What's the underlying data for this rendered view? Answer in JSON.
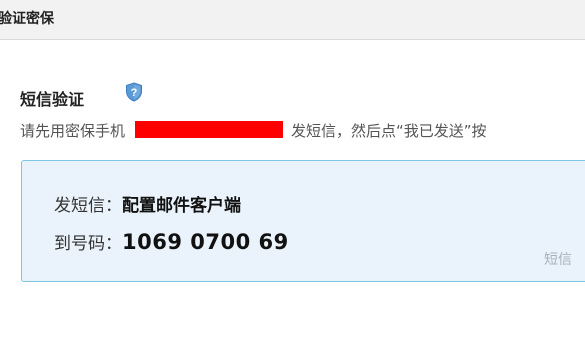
{
  "header": {
    "title": "验证密保"
  },
  "sms_section": {
    "title": "短信验证",
    "help_icon": "shield-question-icon",
    "instruction_prefix": "请先用密保手机",
    "instruction_suffix": "发短信，然后点“我已发送”按"
  },
  "sms_box": {
    "content_label": "发短信：",
    "content_value": "配置邮件客户端",
    "number_label": "到号码：",
    "number_value": "1069 0700 69",
    "hint": "短信"
  },
  "colors": {
    "redaction": "#ff0000",
    "box_background": "#eaf3fb",
    "box_border": "#7cc6e8",
    "shield": "#5b9bd5"
  }
}
